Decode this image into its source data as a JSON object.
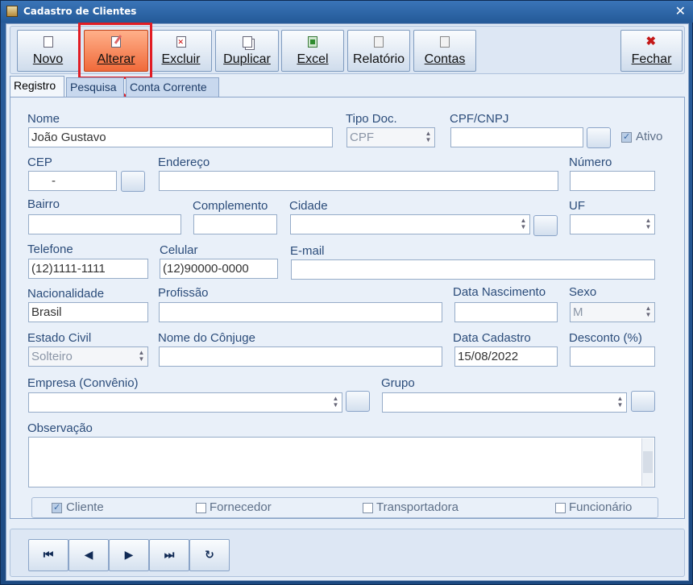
{
  "window": {
    "title": "Cadastro de Clientes",
    "close_glyph": "✕"
  },
  "toolbar": {
    "novo": "Novo",
    "alterar": "Alterar",
    "excluir": "Excluir",
    "duplicar": "Duplicar",
    "excel": "Excel",
    "relatorio": "Relatório",
    "contas": "Contas",
    "fechar": "Fechar"
  },
  "tabs": [
    "Registro",
    "Pesquisa",
    "Conta Corrente"
  ],
  "form": {
    "nome": {
      "label": "Nome",
      "value": "João Gustavo"
    },
    "tipo_doc": {
      "label": "Tipo Doc.",
      "value": "CPF"
    },
    "cpf_cnpj": {
      "label": "CPF/CNPJ",
      "value": ""
    },
    "ativo": {
      "label": "Ativo",
      "checked": true
    },
    "cep": {
      "label": "CEP",
      "value": "      -"
    },
    "endereco": {
      "label": "Endereço",
      "value": ""
    },
    "numero": {
      "label": "Número",
      "value": ""
    },
    "bairro": {
      "label": "Bairro",
      "value": ""
    },
    "complemento": {
      "label": "Complemento",
      "value": ""
    },
    "cidade": {
      "label": "Cidade",
      "value": ""
    },
    "uf": {
      "label": "UF",
      "value": ""
    },
    "telefone": {
      "label": "Telefone",
      "value": "(12)1111-1111"
    },
    "celular": {
      "label": "Celular",
      "value": "(12)90000-0000"
    },
    "email": {
      "label": "E-mail",
      "value": ""
    },
    "nacionalidade": {
      "label": "Nacionalidade",
      "value": "Brasil"
    },
    "profissao": {
      "label": "Profissão",
      "value": ""
    },
    "data_nascimento": {
      "label": "Data Nascimento",
      "value": ""
    },
    "sexo": {
      "label": "Sexo",
      "value": "M"
    },
    "estado_civil": {
      "label": "Estado Civil",
      "value": "Solteiro"
    },
    "nome_conjuge": {
      "label": "Nome do Cônjuge",
      "value": ""
    },
    "data_cadastro": {
      "label": "Data Cadastro",
      "value": "15/08/2022"
    },
    "desconto": {
      "label": "Desconto (%)",
      "value": ""
    },
    "empresa": {
      "label": "Empresa (Convênio)",
      "value": ""
    },
    "grupo": {
      "label": "Grupo",
      "value": ""
    },
    "observacao": {
      "label": "Observação",
      "value": ""
    }
  },
  "types": {
    "cliente": {
      "label": "Cliente",
      "checked": true
    },
    "fornecedor": {
      "label": "Fornecedor",
      "checked": false
    },
    "transportadora": {
      "label": "Transportadora",
      "checked": false
    },
    "funcionario": {
      "label": "Funcionário",
      "checked": false
    }
  },
  "nav": {
    "first": "⏮",
    "prev": "◀",
    "next": "▶",
    "last": "⏭",
    "refresh": "↻"
  },
  "colors": {
    "highlight": "#e11c24",
    "active_button": "#f06a3a"
  }
}
